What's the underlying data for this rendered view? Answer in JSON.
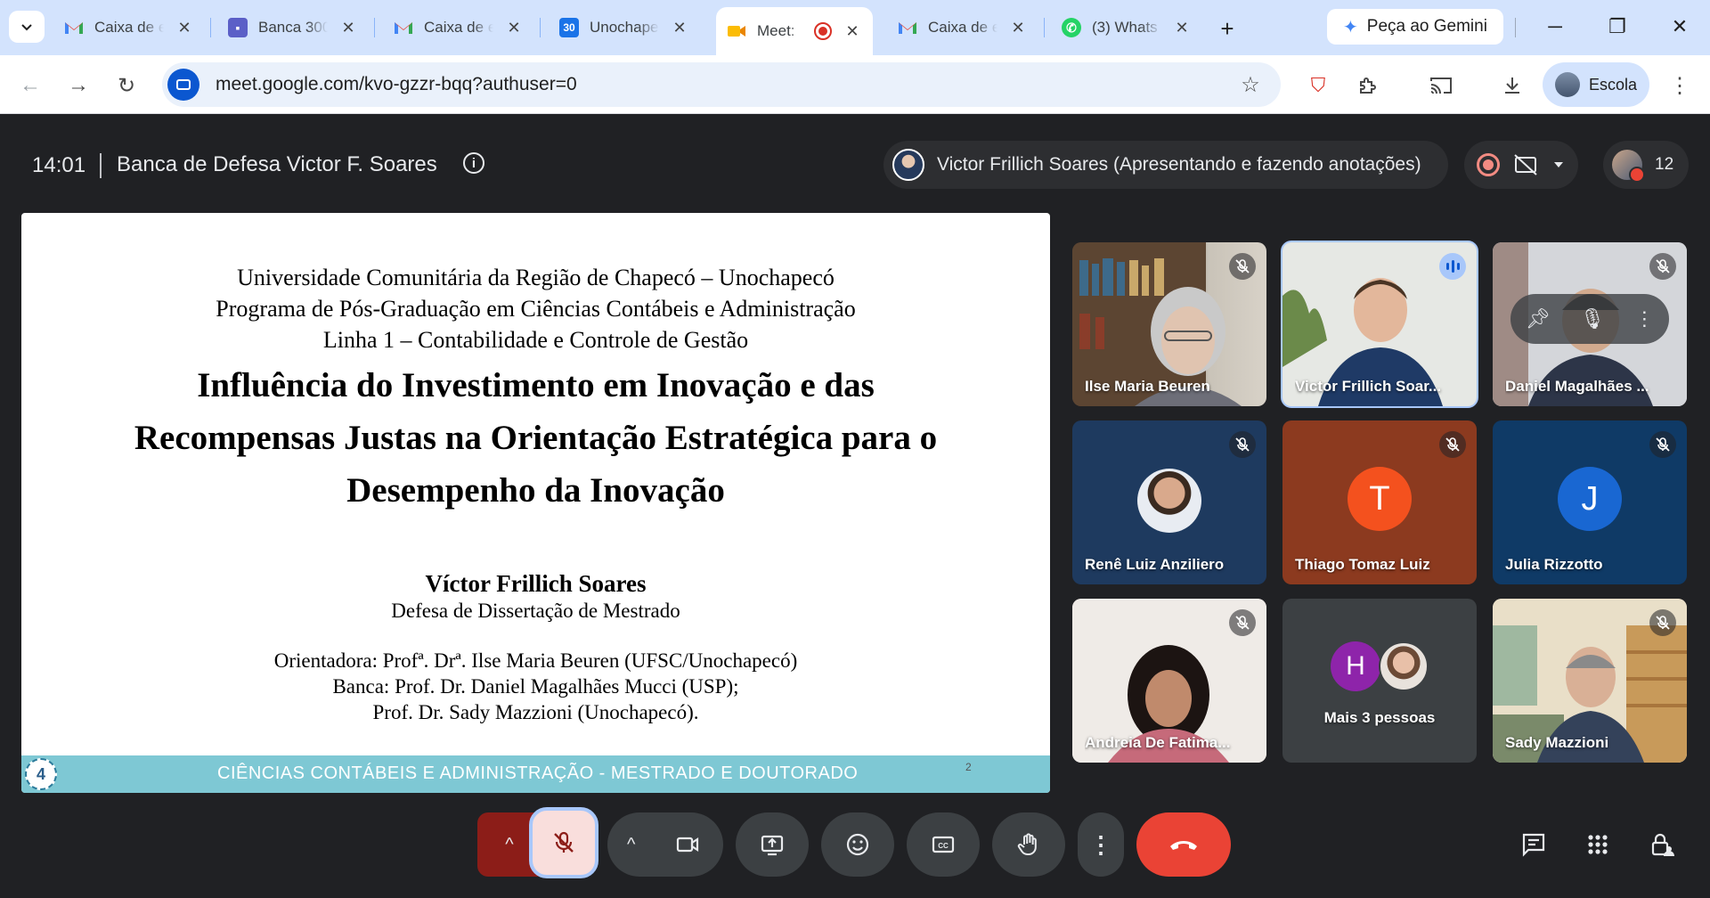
{
  "browser": {
    "tabs": [
      {
        "title": "Caixa de e",
        "icon": "gmail-icon",
        "close": "✕"
      },
      {
        "title": "Banca 300",
        "icon": "teams-icon",
        "close": "✕"
      },
      {
        "title": "Caixa de e",
        "icon": "gmail-icon",
        "close": "✕"
      },
      {
        "title": "Unochape",
        "icon": "calendar-icon",
        "icon_text": "30",
        "close": "✕"
      },
      {
        "title": "Meet:",
        "icon": "meet-icon",
        "close": "✕",
        "active": true
      },
      {
        "title": "Caixa de e",
        "icon": "gmail-icon",
        "close": "✕"
      },
      {
        "title": "(3) Whats",
        "icon": "whatsapp-icon",
        "close": "✕"
      }
    ],
    "new_tab": "+",
    "gemini_button": "Peça ao Gemini",
    "url": "meet.google.com/kvo-gzzr-bqq?authuser=0",
    "profile_label": "Escola",
    "window_controls": {
      "minimize": "─",
      "restore": "❐",
      "close": "✕"
    }
  },
  "meet": {
    "time": "14:01",
    "title": "Banca de Defesa Victor F. Soares",
    "info": "i",
    "presenter_status": "Victor Frillich Soares (Apresentando e fazendo anotações)",
    "participant_count": "12",
    "colors": {
      "background": "#202124",
      "tile": "#3c4043",
      "end_call": "#ea4335",
      "accent": "#a8c7fa"
    }
  },
  "slide": {
    "institution": [
      "Universidade Comunitária da Região de Chapecó – Unochapecó",
      "Programa de Pós-Graduação em Ciências Contábeis e Administração",
      "Linha 1 – Contabilidade e Controle de Gestão"
    ],
    "title_lines": [
      "Influência do Investimento em Inovação e das",
      "Recompensas Justas na Orientação Estratégica para o",
      "Desempenho da Inovação"
    ],
    "author": "Víctor Frillich Soares",
    "subtitle": "Defesa de Dissertação de Mestrado",
    "committee": [
      "Orientadora: Profª. Drª. Ilse Maria Beuren (UFSC/Unochapecó)",
      "Banca: Prof. Dr. Daniel Magalhães Mucci (USP);",
      "Prof. Dr. Sady Mazzioni (Unochapecó)."
    ],
    "footer": "CIÊNCIAS CONTÁBEIS E ADMINISTRAÇÃO - MESTRADO E DOUTORADO",
    "page_number": "2",
    "logo_text": "4"
  },
  "participants": [
    {
      "name": "Ilse Maria Beuren",
      "type": "video",
      "muted": true
    },
    {
      "name": "Victor Frillich Soar...",
      "type": "video",
      "speaking": true
    },
    {
      "name": "Daniel Magalhães ...",
      "type": "video",
      "muted": true,
      "hovered": true
    },
    {
      "name": "Renê Luiz Anziliero",
      "type": "avatar",
      "muted": true
    },
    {
      "name": "Thiago Tomaz Luiz",
      "type": "initial",
      "initial": "T",
      "color": "#f4511e",
      "muted": true
    },
    {
      "name": "Julia Rizzotto",
      "type": "initial",
      "initial": "J",
      "color": "#1967d2",
      "muted": true
    },
    {
      "name": "Andreia De Fatima...",
      "type": "video",
      "muted": true
    },
    {
      "name": "Mais 3 pessoas",
      "type": "more",
      "initial": "H"
    },
    {
      "name": "Sady Mazzioni",
      "type": "video",
      "muted": true
    }
  ],
  "controls": {
    "mic_options": "^",
    "cam_options": "^"
  }
}
